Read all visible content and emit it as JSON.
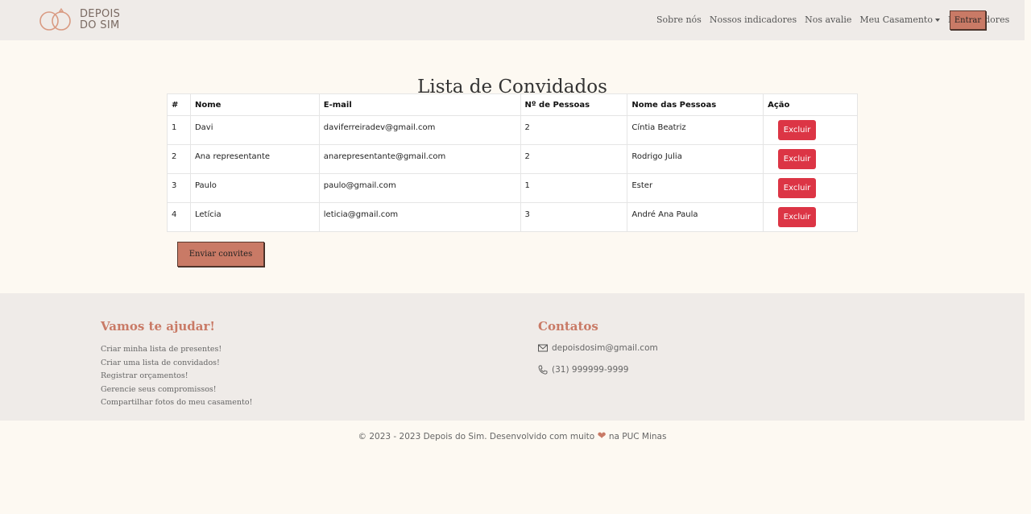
{
  "brand": {
    "line1": "DEPOIS",
    "line2": "DO SIM"
  },
  "nav": {
    "items": [
      "Sobre nós",
      "Nossos indicadores",
      "Nos avalie",
      "Meu Casamento",
      "Fornecedores"
    ],
    "login": "Entrar"
  },
  "page": {
    "title": "Lista de Convidados"
  },
  "table": {
    "headers": [
      "#",
      "Nome",
      "E-mail",
      "Nº de Pessoas",
      "Nome das Pessoas",
      "Ação"
    ],
    "rows": [
      {
        "n": "1",
        "name": "Davi",
        "email": "daviferreiradev@gmail.com",
        "people": "2",
        "names": "Cíntia Beatriz",
        "action": "Excluir"
      },
      {
        "n": "2",
        "name": "Ana representante",
        "email": "anarepresentante@gmail.com",
        "people": "2",
        "names": "Rodrigo Julia",
        "action": "Excluir"
      },
      {
        "n": "3",
        "name": "Paulo",
        "email": "paulo@gmail.com",
        "people": "1",
        "names": "Ester",
        "action": "Excluir"
      },
      {
        "n": "4",
        "name": "Letícia",
        "email": "leticia@gmail.com",
        "people": "3",
        "names": "André Ana Paula",
        "action": "Excluir"
      }
    ]
  },
  "send_button": "Enviar convites",
  "footer": {
    "help_title": "Vamos te ajudar!",
    "help_items": [
      "Criar minha lista de presentes!",
      "Criar uma lista de convidados!",
      "Registrar orçamentos!",
      "Gerencie seus compromissos!",
      "Compartilhar fotos do meu casamento!"
    ],
    "contacts_title": "Contatos",
    "email": "depoisdosim@gmail.com",
    "phone": "(31) 999999-9999",
    "copyright_pre": "© 2023 - 2023 Depois do Sim. Desenvolvido com muito",
    "copyright_post": "na PUC Minas"
  },
  "colors": {
    "accent": "#c97a66",
    "danger": "#dc3545",
    "nav_bg": "#efebe8",
    "page_bg": "#fdf9f2"
  },
  "icons": {
    "logo": "rings-icon",
    "email": "envelope-icon",
    "phone": "phone-icon",
    "heart": "heart-icon"
  }
}
